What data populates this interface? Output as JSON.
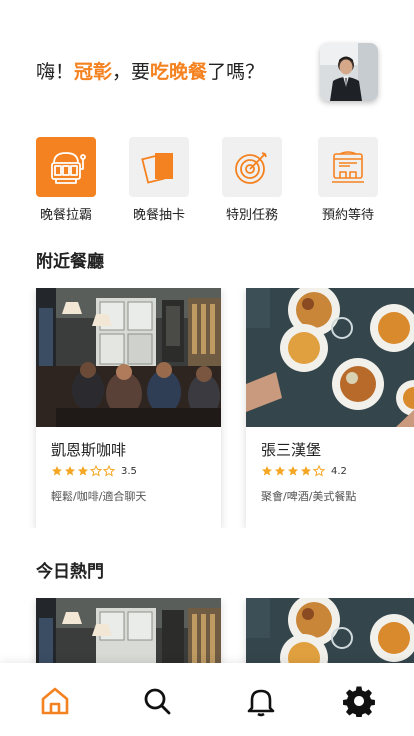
{
  "greeting": {
    "prefix": "嗨！",
    "name": "冠彰",
    "middle": "，要",
    "action": "吃晚餐",
    "suffix": "了嗎？"
  },
  "quick_actions": [
    {
      "label": "晚餐拉霸",
      "icon": "slot-machine-icon",
      "active": true
    },
    {
      "label": "晚餐抽卡",
      "icon": "cards-icon",
      "active": false
    },
    {
      "label": "特別任務",
      "icon": "target-icon",
      "active": false
    },
    {
      "label": "預約等待",
      "icon": "reservation-icon",
      "active": false
    }
  ],
  "sections": {
    "nearby": "附近餐廳",
    "popular": "今日熱門"
  },
  "nearby_restaurants": [
    {
      "name": "凱恩斯咖啡",
      "rating": 3.5,
      "rating_text": "3.5",
      "tags": "輕鬆/咖啡/適合聊天"
    },
    {
      "name": "張三漢堡",
      "rating": 4.2,
      "rating_text": "4.2",
      "tags": "聚會/啤酒/美式餐點"
    }
  ],
  "colors": {
    "accent": "#f58220",
    "text": "#222222"
  },
  "nav": [
    "home-icon",
    "search-icon",
    "bell-icon",
    "gear-icon"
  ]
}
